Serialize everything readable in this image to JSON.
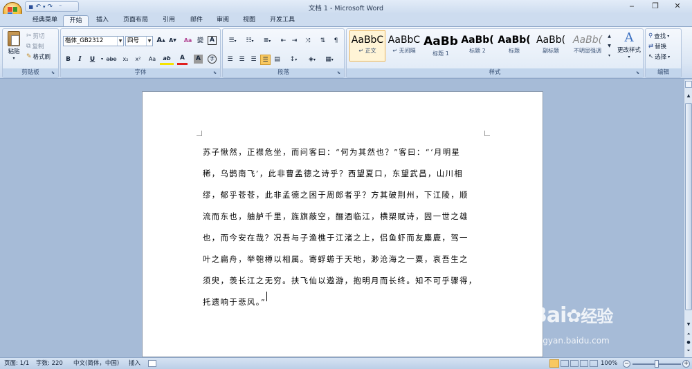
{
  "window": {
    "title": "文档 1 - Microsoft Word",
    "minimize_icon": "minimize-icon",
    "restore_icon": "restore-icon",
    "close_icon": "close-icon",
    "min_glyph": "‒",
    "restore_glyph": "❐",
    "close_glyph": "✕"
  },
  "qat": {
    "save_glyph": "▪",
    "undo_glyph": "↶",
    "undo_dd_glyph": "▾",
    "redo_glyph": "↷",
    "customize_glyph": "⁼"
  },
  "tabs": [
    "经典菜单",
    "开始",
    "插入",
    "页面布局",
    "引用",
    "邮件",
    "审阅",
    "视图",
    "开发工具"
  ],
  "active_tab": "开始",
  "clipboard": {
    "group_label": "剪贴板",
    "paste": "粘贴",
    "cut": "剪切",
    "copy": "复制",
    "format_painter": "格式刷",
    "paste_arrow": "▾"
  },
  "font": {
    "group_label": "字体",
    "font_name": "楷体_GB2312",
    "font_size": "四号",
    "grow": "A",
    "shrink": "A",
    "clear": "Aa",
    "phonetic": "變",
    "border_char": "A",
    "bold": "B",
    "italic": "I",
    "underline": "U",
    "strike": "abe",
    "subscript": "x₂",
    "superscript": "x²",
    "case": "Aa",
    "highlight_glyph": "ab",
    "font_color_glyph": "A",
    "shading_char": "A",
    "enclose_char": "字"
  },
  "paragraph": {
    "group_label": "段落"
  },
  "styles": {
    "group_label": "样式",
    "change_styles": "更改样式",
    "items": [
      {
        "sample": "AaBbC",
        "name": "↵ 正文"
      },
      {
        "sample": "AaBbC",
        "name": "↵ 无间隔"
      },
      {
        "sample": "AaBb",
        "name": "标题 1"
      },
      {
        "sample": "AaBb(",
        "name": "标题 2"
      },
      {
        "sample": "AaBb(",
        "name": "标题"
      },
      {
        "sample": "AaBb(",
        "name": "副标题"
      },
      {
        "sample": "AaBb(",
        "name": "不明显强调"
      }
    ]
  },
  "editing": {
    "group_label": "编辑",
    "find": "查找",
    "replace": "替换",
    "select": "选择"
  },
  "document": {
    "lines": [
      "苏子愀然，正襟危坐，而问客曰：“何为其然也？”客曰：“‘月明星",
      "稀，乌鹊南飞’，此非曹孟德之诗乎？西望夏口，东望武昌，山川相",
      "缪，郁乎苍苍，此非孟德之困于周郎者乎？方其破荆州，下江陵，顺",
      "流而东也，舳舻千里，旌旗蔽空，酾酒临江，横槊赋诗，固一世之雄",
      "也，而今安在哉？况吾与子渔樵于江渚之上，侣鱼虾而友麋鹿，驾一",
      "叶之扁舟，举匏樽以相属。寄蜉蝣于天地，渺沧海之一粟，哀吾生之",
      "须臾，羡长江之无穷。挟飞仙以遨游，抱明月而长终。知不可乎骤得，",
      "托遗响于悲风。”"
    ]
  },
  "status": {
    "page": "页面: 1/1",
    "words": "字数: 220",
    "language": "中文(简体，中国)",
    "mode": "插入",
    "zoom": "100%",
    "zoom_out": "−",
    "zoom_in": "+",
    "zoom_level_fraction": 0.5
  },
  "watermark": {
    "brand": "Bai",
    "brand_suffix": "经验",
    "url": "jingyan.baidu.com"
  },
  "colors": {
    "ribbon_bg": "#dbe6f4",
    "workspace": "#a6bbd7",
    "selected_style": "#f0b550",
    "highlight": "#f5e300",
    "font_color": "#e02020"
  }
}
